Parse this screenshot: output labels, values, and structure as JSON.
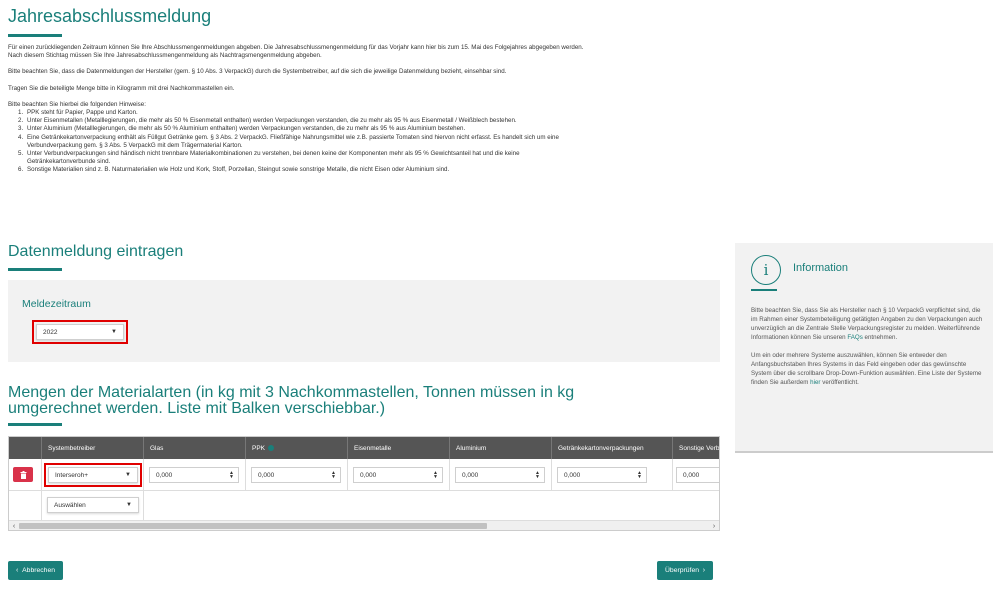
{
  "page": {
    "title": "Jahresabschlussmeldung",
    "intro": [
      "Für einen zurückliegenden Zeitraum können Sie Ihre Abschlussmengenmeldungen abgeben. Die Jahresabschlussmengenmeldung für das Vorjahr kann hier bis zum 15. Mai des Folgejahres abgegeben werden.",
      "Nach diesem Stichtag müssen Sie Ihre Jahresabschlussmengenmeldung als Nachtragsmengenmeldung abgeben.",
      "Bitte beachten Sie, dass die Datenmeldungen der Hersteller (gem. § 10 Abs. 3 VerpackG) durch die Systembetreiber, auf die sich die jeweilige Datenmeldung bezieht, einsehbar sind.",
      "Tragen Sie die beteiligte Menge bitte in Kilogramm mit drei Nachkommastellen ein.",
      "Bitte beachten Sie hierbei die folgenden Hinweise:"
    ],
    "hints": [
      {
        "num": "1.",
        "lines": [
          "PPK steht für Papier, Pappe und Karton."
        ]
      },
      {
        "num": "2.",
        "lines": [
          "Unter Eisenmetallen (Metalllegierungen, die mehr als 50 % Eisenmetall enthalten) werden Verpackungen verstanden, die zu mehr als 95 % aus Eisenmetall / Weißblech bestehen."
        ]
      },
      {
        "num": "3.",
        "lines": [
          "Unter Aluminium (Metalllegierungen, die mehr als 50 % Aluminium enthalten) werden Verpackungen verstanden, die zu mehr als 95 % aus Aluminium bestehen."
        ]
      },
      {
        "num": "4.",
        "lines": [
          "Eine Getränkekartonverpackung enthält als Füllgut Getränke gem. § 3 Abs. 2 VerpackG. Fließfähige Nahrungsmittel wie z.B. passierte Tomaten sind hiervon nicht erfasst. Es handelt sich um eine",
          "Verbundverpackung gem. § 3 Abs. 5 VerpackG mit dem Trägermaterial Karton."
        ]
      },
      {
        "num": "5.",
        "lines": [
          "Unter Verbundverpackungen sind händisch nicht trennbare Materialkombinationen zu verstehen, bei denen keine der Komponenten mehr als 95 % Gewichtsanteil hat und die keine",
          "Getränkekartonverbunde sind."
        ]
      },
      {
        "num": "6.",
        "lines": [
          "Sonstige Materialien sind z. B. Naturmaterialien wie Holz und Kork, Stoff, Porzellan, Steingut sowie sonstrige Metalle, die nicht Eisen oder Aluminium sind."
        ]
      }
    ]
  },
  "datenmeldung": {
    "title": "Datenmeldung eintragen",
    "period_label": "Meldezeitraum",
    "period_value": "2022"
  },
  "mengen": {
    "title_line1": "Mengen der Materialarten (in kg mit 3 Nachkommastellen, Tonnen müssen in kg",
    "title_line2": "umgerechnet werden. Liste mit Balken verschiebbar.)",
    "headers": [
      "Systembetreiber",
      "Glas",
      "PPK",
      "Eisenmetalle",
      "Aluminium",
      "Getränkekartonverpackungen",
      "Sonstige Verb"
    ],
    "row": {
      "system": "Interseroh+",
      "values": [
        "0,000",
        "0,000",
        "0,000",
        "0,000",
        "0,000",
        "0,000"
      ]
    },
    "add_select": "Auswählen"
  },
  "info": {
    "title": "Information",
    "p1_pre": "Bitte beachten Sie, dass Sie als Hersteller nach § 10 VerpackG verpflichtet sind, die im Rahmen einer Systembeteiligung getätigten Angaben zu den Verpackungen auch unverzüglich an die Zentrale Stelle Verpackungsregister zu melden. Weiterführende Informationen können Sie unseren ",
    "p1_link": "FAQs",
    "p1_post": " entnehmen.",
    "p2_pre": "Um ein oder mehrere Systeme auszuwählen, können Sie entweder den Anfangsbuchstaben Ihres Systems in das Feld eingeben oder das gewünschte System über die scrollbare Drop-Down-Funktion auswählen. Eine Liste der Systeme finden Sie außerdem ",
    "p2_link": "hier",
    "p2_post": " veröffentlicht."
  },
  "buttons": {
    "cancel": "Abbrechen",
    "check": "Überprüfen"
  },
  "colors": {
    "accent": "#1a7f7a",
    "danger": "#d9324a",
    "highlight": "#e00000"
  }
}
